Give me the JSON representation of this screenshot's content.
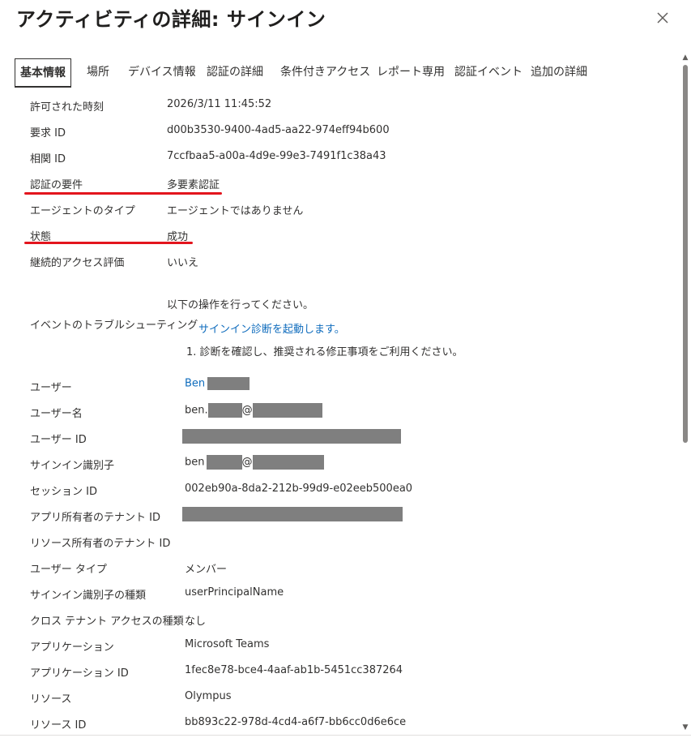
{
  "header": {
    "title": "アクティビティの詳細: サインイン"
  },
  "tabs": [
    {
      "label": "基本情報",
      "active": true
    },
    {
      "label": "場所"
    },
    {
      "label": "デバイス情報"
    },
    {
      "label": "認証の詳細"
    },
    {
      "label": "条件付きアクセス"
    },
    {
      "label": "レポート専用"
    },
    {
      "label": "認証イベント"
    },
    {
      "label": "追加の詳細"
    }
  ],
  "details": {
    "allowed_time": {
      "label": "許可された時刻",
      "value": "2026/3/11 11:45:52"
    },
    "request_id": {
      "label": "要求 ID",
      "value": "d00b3530-9400-4ad5-aa22-974eff94b600"
    },
    "correlation_id": {
      "label": "相関 ID",
      "value": "7ccfbaa5-a00a-4d9e-99e3-7491f1c38a43"
    },
    "auth_requirement": {
      "label": "認証の要件",
      "value": "多要素認証"
    },
    "agent_type": {
      "label": "エージェントのタイプ",
      "value": "エージェントではありません"
    },
    "status": {
      "label": "状態",
      "value": "成功"
    },
    "continuous_access": {
      "label": "継続的アクセス評価",
      "value": "いいえ"
    }
  },
  "troubleshoot": {
    "label": "イベントのトラブルシューティング",
    "intro": "以下の操作を行ってください。",
    "link": "サインイン診断を起動します。",
    "step1": "1. 診断を確認し、推奨される修正事項をご利用ください。"
  },
  "user": {
    "user": {
      "label": "ユーザー",
      "value": "Ben"
    },
    "username": {
      "label": "ユーザー名",
      "value": "ben.",
      "at": "@"
    },
    "user_id": {
      "label": "ユーザー ID"
    },
    "signin_identifier": {
      "label": "サインイン識別子",
      "value": "ben",
      "at": "@"
    },
    "session_id": {
      "label": "セッション ID",
      "value": "002eb90a-8da2-212b-99d9-e02eeb500ea0"
    },
    "app_owner_tenant": {
      "label": "アプリ所有者のテナント ID"
    },
    "resource_owner_tenant": {
      "label": "リソース所有者のテナント ID"
    },
    "user_type": {
      "label": "ユーザー タイプ",
      "value": "メンバー"
    },
    "identifier_type": {
      "label": "サインイン識別子の種類",
      "value": "userPrincipalName"
    },
    "cross_tenant": {
      "label": "クロス テナント アクセスの種類",
      "value": "なし"
    },
    "application": {
      "label": "アプリケーション",
      "value": "Microsoft Teams"
    },
    "application_id": {
      "label": "アプリケーション ID",
      "value": "1fec8e78-bce4-4aaf-ab1b-5451cc387264"
    },
    "resource": {
      "label": "リソース",
      "value": "Olympus"
    },
    "resource_id": {
      "label": "リソース ID",
      "value": "bb893c22-978d-4cd4-a6f7-bb6cc0d6e6ce"
    }
  },
  "colors": {
    "link": "#0f6cbd",
    "highlight": "#e3151d",
    "redaction": "#7f7f7f"
  }
}
